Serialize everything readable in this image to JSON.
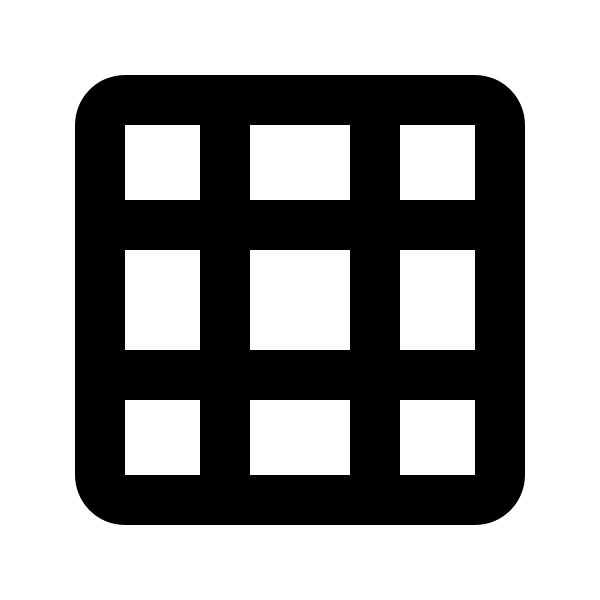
{
  "icon": {
    "name": "grid-icon",
    "rows": 3,
    "columns": 3,
    "colors": {
      "foreground": "#000000",
      "background": "#ffffff"
    }
  }
}
